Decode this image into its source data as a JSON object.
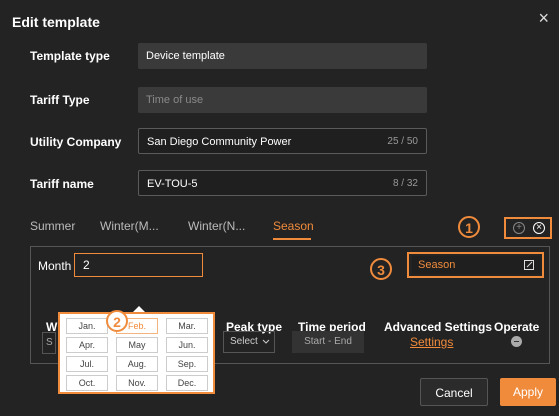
{
  "dialog": {
    "title": "Edit template",
    "close_glyph": "×"
  },
  "form": {
    "template_type": {
      "label": "Template type",
      "value": "Device template"
    },
    "tariff_type": {
      "label": "Tariff Type",
      "placeholder": "Time of use"
    },
    "utility_company": {
      "label": "Utility Company",
      "value": "San Diego Community Power",
      "counter": "25 / 50"
    },
    "tariff_name": {
      "label": "Tariff name",
      "value": "EV-TOU-5",
      "counter": "8 / 32"
    }
  },
  "tabs": [
    {
      "label": "Summer"
    },
    {
      "label": "Winter(M..."
    },
    {
      "label": "Winter(N..."
    },
    {
      "label": "Season"
    }
  ],
  "season_panel": {
    "month_label": "Month",
    "month_value": "2",
    "season_value": "Season",
    "months": [
      "Jan.",
      "Feb.",
      "Mar.",
      "Apr.",
      "May",
      "Jun.",
      "Jul.",
      "Aug.",
      "Sep.",
      "Oct.",
      "Nov.",
      "Dec."
    ],
    "selected_month": "Feb.",
    "columns": {
      "first": "W",
      "peak_type": "Peak type",
      "time_period": "Time period",
      "advanced": "Advanced Settings",
      "operate": "Operate"
    },
    "row": {
      "first_cell": "S",
      "select_label": "Select",
      "time_start": "Start",
      "time_sep": "-",
      "time_end": "End",
      "settings_link": "Settings"
    }
  },
  "annotations": {
    "one": "1",
    "two": "2",
    "three": "3"
  },
  "footer": {
    "cancel": "Cancel",
    "apply": "Apply"
  },
  "colors": {
    "accent": "#f08b3c",
    "background": "#232323",
    "field": "#3a3a3a"
  },
  "icons": {
    "add": "add-circle-icon",
    "remove": "close-circle-icon",
    "edit": "edit-icon",
    "chevron": "chevron-down-icon",
    "minus": "minus-circle-icon"
  }
}
